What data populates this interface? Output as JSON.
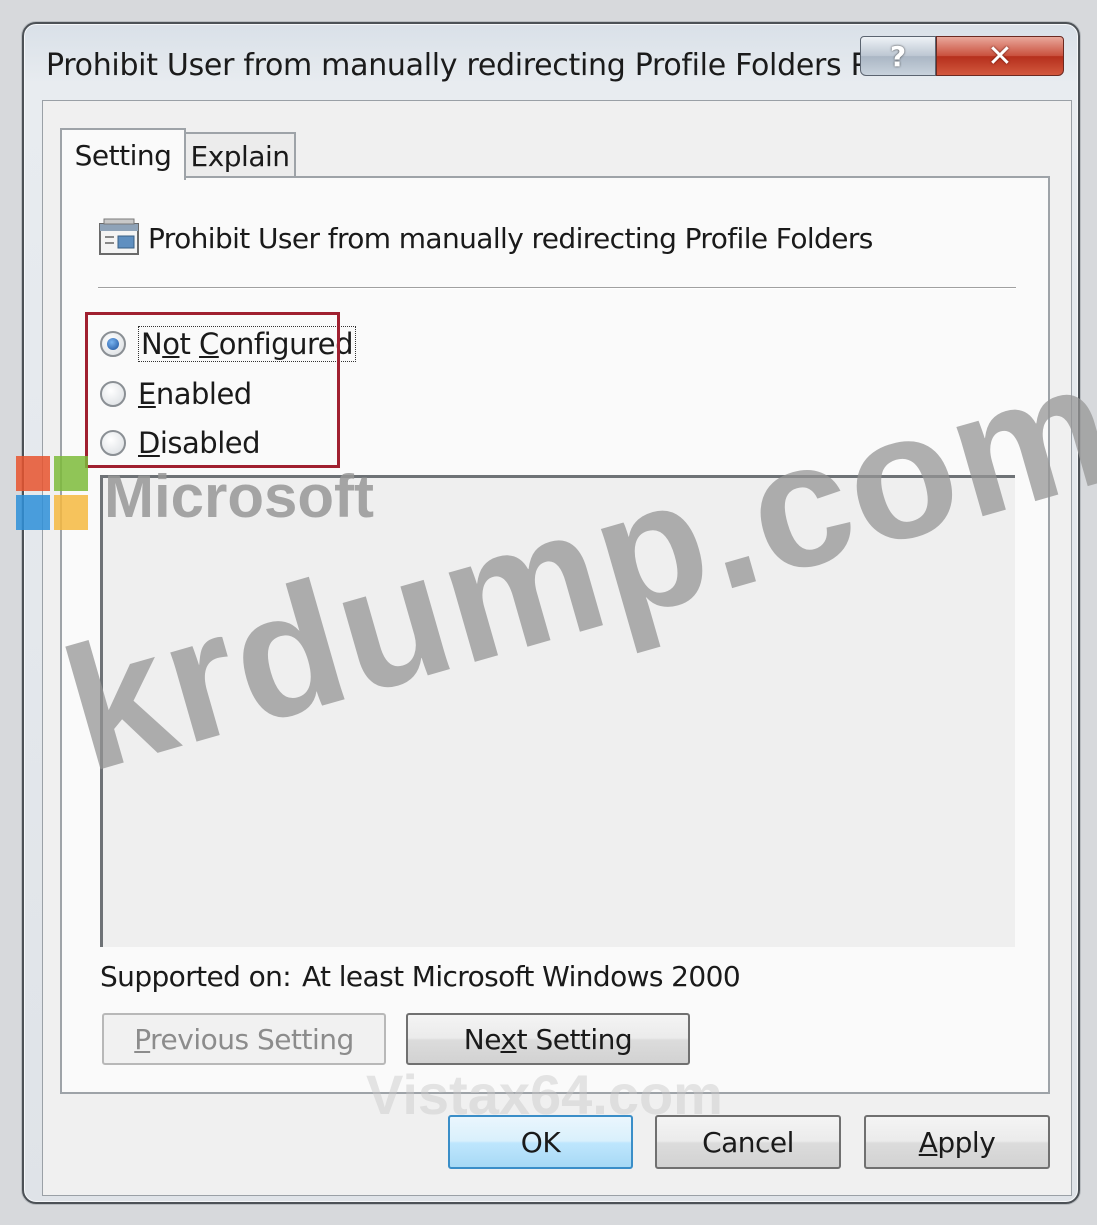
{
  "window": {
    "title": "Prohibit User from manually redirecting Profile Folders Pr...",
    "help_glyph": "?",
    "close_glyph": "✕"
  },
  "tabs": [
    {
      "label": "Setting",
      "active": true
    },
    {
      "label": "Explain",
      "active": false
    }
  ],
  "policy": {
    "title": "Prohibit User from manually redirecting Profile Folders"
  },
  "options": {
    "not_configured": {
      "first": "N",
      "underline": "o",
      "rest": "t ",
      "second_underline": "C",
      "tail": "onfigured",
      "selected": true
    },
    "enabled": {
      "underline": "E",
      "rest": "nabled",
      "selected": false
    },
    "disabled": {
      "underline": "D",
      "rest": "isabled",
      "selected": false
    }
  },
  "supported": {
    "label": "Supported on:",
    "value": "At least Microsoft Windows 2000"
  },
  "nav_buttons": {
    "previous": {
      "underline": "P",
      "rest": "revious Setting",
      "enabled": false
    },
    "next": {
      "first": "Ne",
      "underline": "x",
      "rest": "t Setting",
      "enabled": true
    }
  },
  "dialog_buttons": {
    "ok": "OK",
    "cancel": "Cancel",
    "apply": {
      "underline": "A",
      "rest": "pply"
    }
  },
  "watermarks": {
    "microsoft": "Microsoft",
    "krdump": "krdump.com",
    "vistax64": "Vistax64.com"
  },
  "colors": {
    "highlight_box": "#a02030",
    "logo_red": "#e8542e",
    "logo_green": "#7cbb3a",
    "logo_blue": "#2e8fd8",
    "logo_yellow": "#f5b840"
  }
}
